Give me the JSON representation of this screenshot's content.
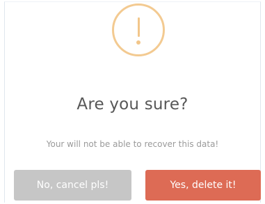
{
  "dialog": {
    "title": "Are you sure?",
    "message": "Your will not be able to recover this data!",
    "icon": "warning-icon",
    "cancel_label": "No, cancel pls!",
    "confirm_label": "Yes, delete it!"
  },
  "colors": {
    "warning_icon": "#f3ca91",
    "title_text": "#575757",
    "message_text": "#9a9a9a",
    "cancel_button": "#c6c6c6",
    "confirm_button": "#dd6b55"
  }
}
